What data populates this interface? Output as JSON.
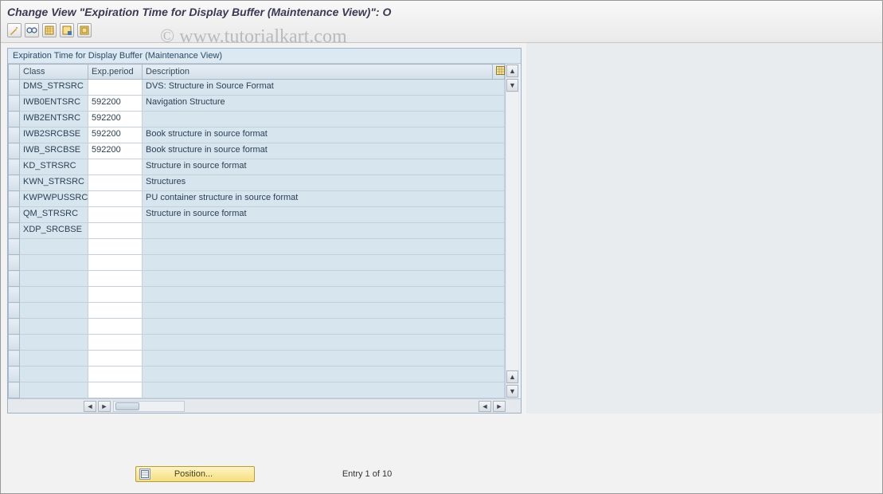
{
  "header": {
    "title": "Change View \"Expiration Time for Display Buffer (Maintenance View)\": O"
  },
  "watermark": "© www.tutorialkart.com",
  "toolbar": {
    "icons": [
      "toggle",
      "glasses",
      "table1",
      "table2",
      "table3"
    ]
  },
  "panel": {
    "title": "Expiration Time for Display Buffer (Maintenance View)",
    "columns": {
      "class": "Class",
      "exp": "Exp.period",
      "desc": "Description"
    },
    "rows": [
      {
        "class": "DMS_STRSRC",
        "exp": "",
        "desc": "DVS: Structure in Source Format"
      },
      {
        "class": "IWB0ENTSRC",
        "exp": "592200",
        "desc": "Navigation Structure"
      },
      {
        "class": "IWB2ENTSRC",
        "exp": "592200",
        "desc": ""
      },
      {
        "class": "IWB2SRCBSE",
        "exp": "592200",
        "desc": "Book structure in source format"
      },
      {
        "class": "IWB_SRCBSE",
        "exp": "592200",
        "desc": "Book structure in source format"
      },
      {
        "class": "KD_STRSRC",
        "exp": "",
        "desc": "Structure in source format"
      },
      {
        "class": "KWN_STRSRC",
        "exp": "",
        "desc": "Structures"
      },
      {
        "class": "KWPWPUSSRC",
        "exp": "",
        "desc": "PU container structure in source format"
      },
      {
        "class": "QM_STRSRC",
        "exp": "",
        "desc": "Structure in source format"
      },
      {
        "class": "XDP_SRCBSE",
        "exp": "",
        "desc": ""
      }
    ],
    "empty_rows": 10
  },
  "footer": {
    "position_label": "Position...",
    "entry_text": "Entry 1 of 10"
  }
}
